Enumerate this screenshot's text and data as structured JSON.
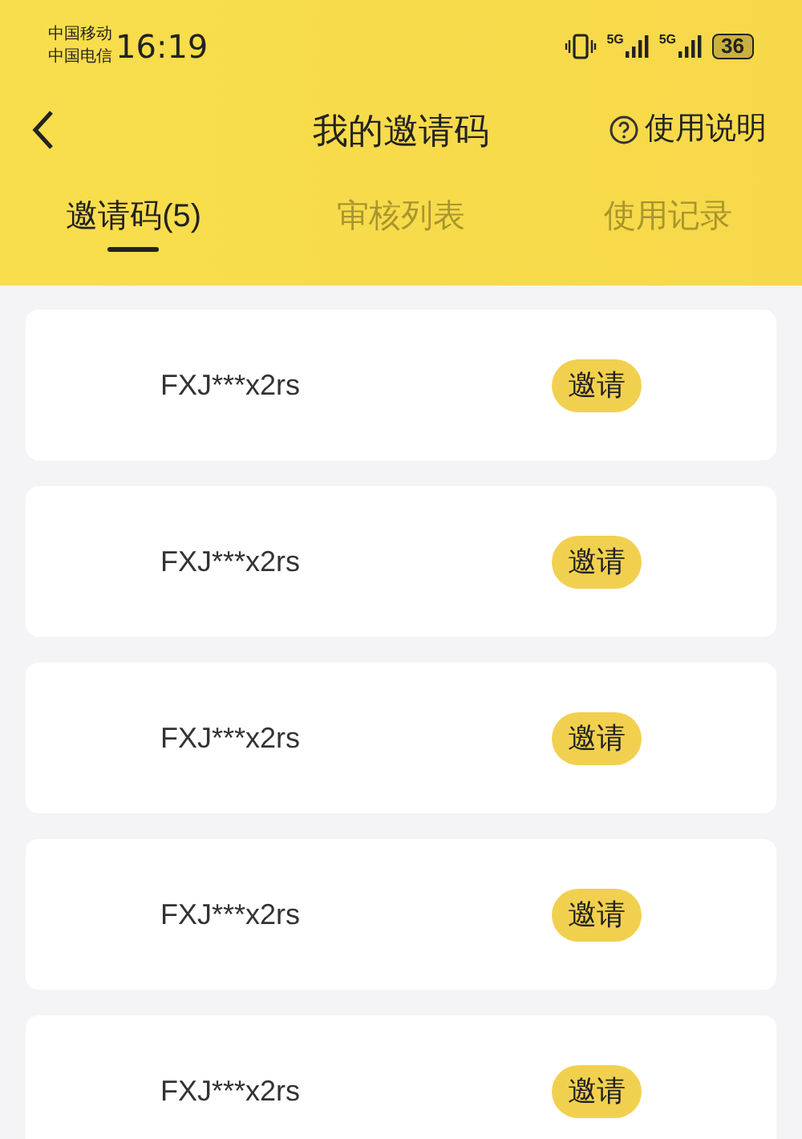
{
  "status_bar": {
    "carriers": [
      "中国移动",
      "中国电信"
    ],
    "time": "16:19",
    "networks": [
      "5G",
      "5G"
    ],
    "battery": "36"
  },
  "nav": {
    "title": "我的邀请码",
    "help": "使用说明"
  },
  "tabs": [
    {
      "label": "邀请码(5)",
      "selected": true
    },
    {
      "label": "审核列表",
      "selected": false
    },
    {
      "label": "使用记录",
      "selected": false
    }
  ],
  "codes": [
    {
      "code": "FXJ***x2rs",
      "action": "邀请"
    },
    {
      "code": "FXJ***x2rs",
      "action": "邀请"
    },
    {
      "code": "FXJ***x2rs",
      "action": "邀请"
    },
    {
      "code": "FXJ***x2rs",
      "action": "邀请"
    },
    {
      "code": "FXJ***x2rs",
      "action": "邀请"
    }
  ]
}
